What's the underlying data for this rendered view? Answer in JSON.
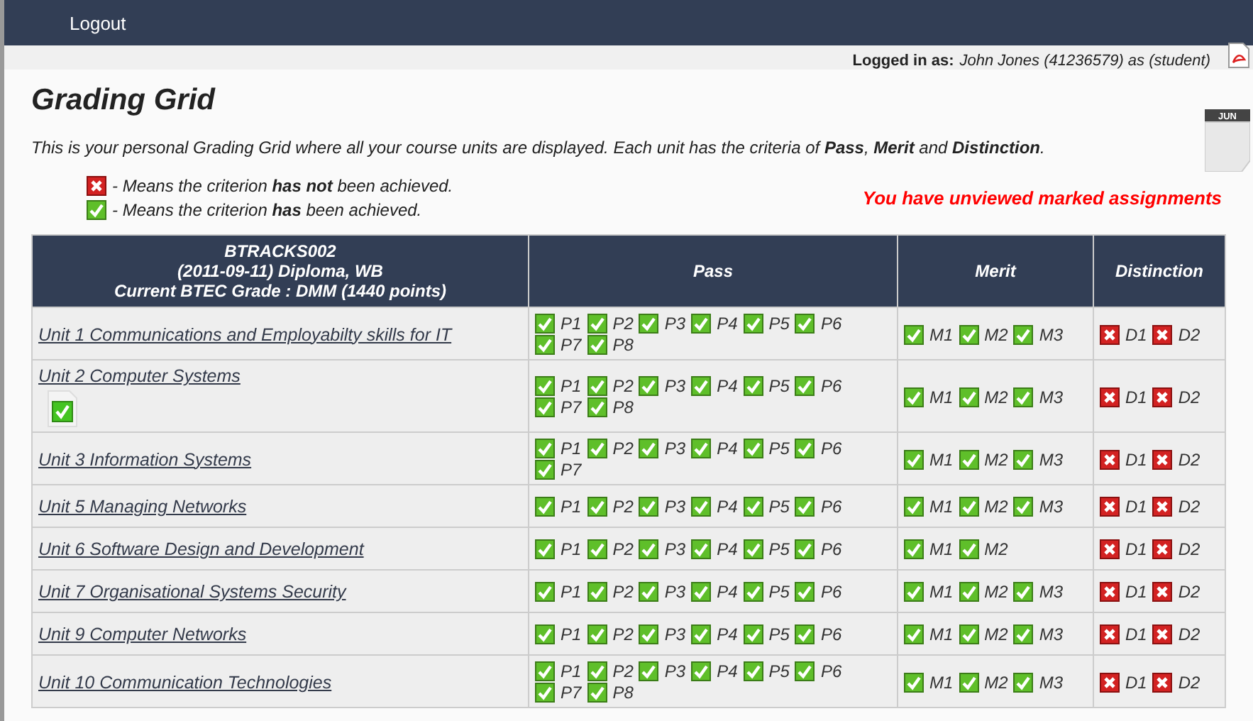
{
  "nav": {
    "logout": "Logout"
  },
  "login": {
    "label": "Logged in as:",
    "user": "John Jones (41236579) as (student)"
  },
  "title": "Grading Grid",
  "calendar_month": "JUN",
  "intro": "This is your personal Grading Grid where all your course units are displayed. Each unit has the criteria of **Pass**, **Merit** and **Distinction**.",
  "legend": [
    {
      "achieved": false,
      "text": "- Means the criterion **has not** been achieved."
    },
    {
      "achieved": true,
      "text": "- Means the criterion **has** been achieved."
    }
  ],
  "alert": "You have unviewed marked assignments",
  "table": {
    "header": [
      "BTRACKS002",
      "(2011-09-11) Diploma, WB",
      "Current BTEC Grade : DMM (1440 points)"
    ],
    "columns": [
      "Pass",
      "Merit",
      "Distinction"
    ],
    "rows": [
      {
        "unit": "Unit 1 Communications and Employabilty skills for IT",
        "submitted": false,
        "pass": [
          [
            "P1",
            true
          ],
          [
            "P2",
            true
          ],
          [
            "P3",
            true
          ],
          [
            "P4",
            true
          ],
          [
            "P5",
            true
          ],
          [
            "P6",
            true
          ],
          [
            "P7",
            true
          ],
          [
            "P8",
            true
          ]
        ],
        "merit": [
          [
            "M1",
            true
          ],
          [
            "M2",
            true
          ],
          [
            "M3",
            true
          ]
        ],
        "distinction": [
          [
            "D1",
            false
          ],
          [
            "D2",
            false
          ]
        ]
      },
      {
        "unit": "Unit 2 Computer Systems",
        "submitted": true,
        "pass": [
          [
            "P1",
            true
          ],
          [
            "P2",
            true
          ],
          [
            "P3",
            true
          ],
          [
            "P4",
            true
          ],
          [
            "P5",
            true
          ],
          [
            "P6",
            true
          ],
          [
            "P7",
            true
          ],
          [
            "P8",
            true
          ]
        ],
        "merit": [
          [
            "M1",
            true
          ],
          [
            "M2",
            true
          ],
          [
            "M3",
            true
          ]
        ],
        "distinction": [
          [
            "D1",
            false
          ],
          [
            "D2",
            false
          ]
        ]
      },
      {
        "unit": "Unit 3 Information Systems",
        "submitted": false,
        "pass": [
          [
            "P1",
            true
          ],
          [
            "P2",
            true
          ],
          [
            "P3",
            true
          ],
          [
            "P4",
            true
          ],
          [
            "P5",
            true
          ],
          [
            "P6",
            true
          ],
          [
            "P7",
            true
          ]
        ],
        "merit": [
          [
            "M1",
            true
          ],
          [
            "M2",
            true
          ],
          [
            "M3",
            true
          ]
        ],
        "distinction": [
          [
            "D1",
            false
          ],
          [
            "D2",
            false
          ]
        ]
      },
      {
        "unit": "Unit 5 Managing Networks",
        "submitted": false,
        "pass": [
          [
            "P1",
            true
          ],
          [
            "P2",
            true
          ],
          [
            "P3",
            true
          ],
          [
            "P4",
            true
          ],
          [
            "P5",
            true
          ],
          [
            "P6",
            true
          ]
        ],
        "merit": [
          [
            "M1",
            true
          ],
          [
            "M2",
            true
          ],
          [
            "M3",
            true
          ]
        ],
        "distinction": [
          [
            "D1",
            false
          ],
          [
            "D2",
            false
          ]
        ]
      },
      {
        "unit": "Unit 6 Software Design and Development",
        "submitted": false,
        "pass": [
          [
            "P1",
            true
          ],
          [
            "P2",
            true
          ],
          [
            "P3",
            true
          ],
          [
            "P4",
            true
          ],
          [
            "P5",
            true
          ],
          [
            "P6",
            true
          ]
        ],
        "merit": [
          [
            "M1",
            true
          ],
          [
            "M2",
            true
          ]
        ],
        "distinction": [
          [
            "D1",
            false
          ],
          [
            "D2",
            false
          ]
        ]
      },
      {
        "unit": "Unit 7 Organisational Systems Security",
        "submitted": false,
        "pass": [
          [
            "P1",
            true
          ],
          [
            "P2",
            true
          ],
          [
            "P3",
            true
          ],
          [
            "P4",
            true
          ],
          [
            "P5",
            true
          ],
          [
            "P6",
            true
          ]
        ],
        "merit": [
          [
            "M1",
            true
          ],
          [
            "M2",
            true
          ],
          [
            "M3",
            true
          ]
        ],
        "distinction": [
          [
            "D1",
            false
          ],
          [
            "D2",
            false
          ]
        ]
      },
      {
        "unit": "Unit 9 Computer Networks",
        "submitted": false,
        "pass": [
          [
            "P1",
            true
          ],
          [
            "P2",
            true
          ],
          [
            "P3",
            true
          ],
          [
            "P4",
            true
          ],
          [
            "P5",
            true
          ],
          [
            "P6",
            true
          ]
        ],
        "merit": [
          [
            "M1",
            true
          ],
          [
            "M2",
            true
          ],
          [
            "M3",
            true
          ]
        ],
        "distinction": [
          [
            "D1",
            false
          ],
          [
            "D2",
            false
          ]
        ]
      },
      {
        "unit": "Unit 10 Communication Technologies",
        "submitted": false,
        "pass": [
          [
            "P1",
            true
          ],
          [
            "P2",
            true
          ],
          [
            "P3",
            true
          ],
          [
            "P4",
            true
          ],
          [
            "P5",
            true
          ],
          [
            "P6",
            true
          ],
          [
            "P7",
            true
          ],
          [
            "P8",
            true
          ]
        ],
        "merit": [
          [
            "M1",
            true
          ],
          [
            "M2",
            true
          ],
          [
            "M3",
            true
          ]
        ],
        "distinction": [
          [
            "D1",
            false
          ],
          [
            "D2",
            false
          ]
        ]
      }
    ]
  }
}
